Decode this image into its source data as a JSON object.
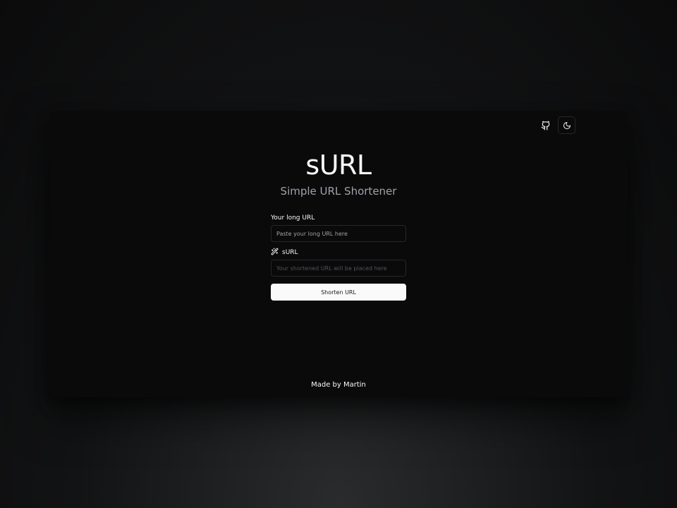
{
  "header": {
    "github_icon": "github-icon",
    "theme_icon": "moon-icon"
  },
  "hero": {
    "title": "sURL",
    "subtitle": "Simple URL Shortener"
  },
  "form": {
    "long_url_label": "Your long URL",
    "long_url_placeholder": "Paste your long URL here",
    "long_url_value": "",
    "short_url_icon": "magic-wand-icon",
    "short_url_label": "sURL",
    "short_url_placeholder": "Your shortened URL will be placed here",
    "short_url_value": "",
    "submit_label": "Shorten URL"
  },
  "footer": {
    "text": "Made by Martin"
  },
  "colors": {
    "background": "#0a0a0b",
    "text": "#fafafa",
    "muted": "#a1a1aa",
    "border": "#27272a",
    "button_bg": "#fafafa",
    "button_text": "#18181b"
  }
}
